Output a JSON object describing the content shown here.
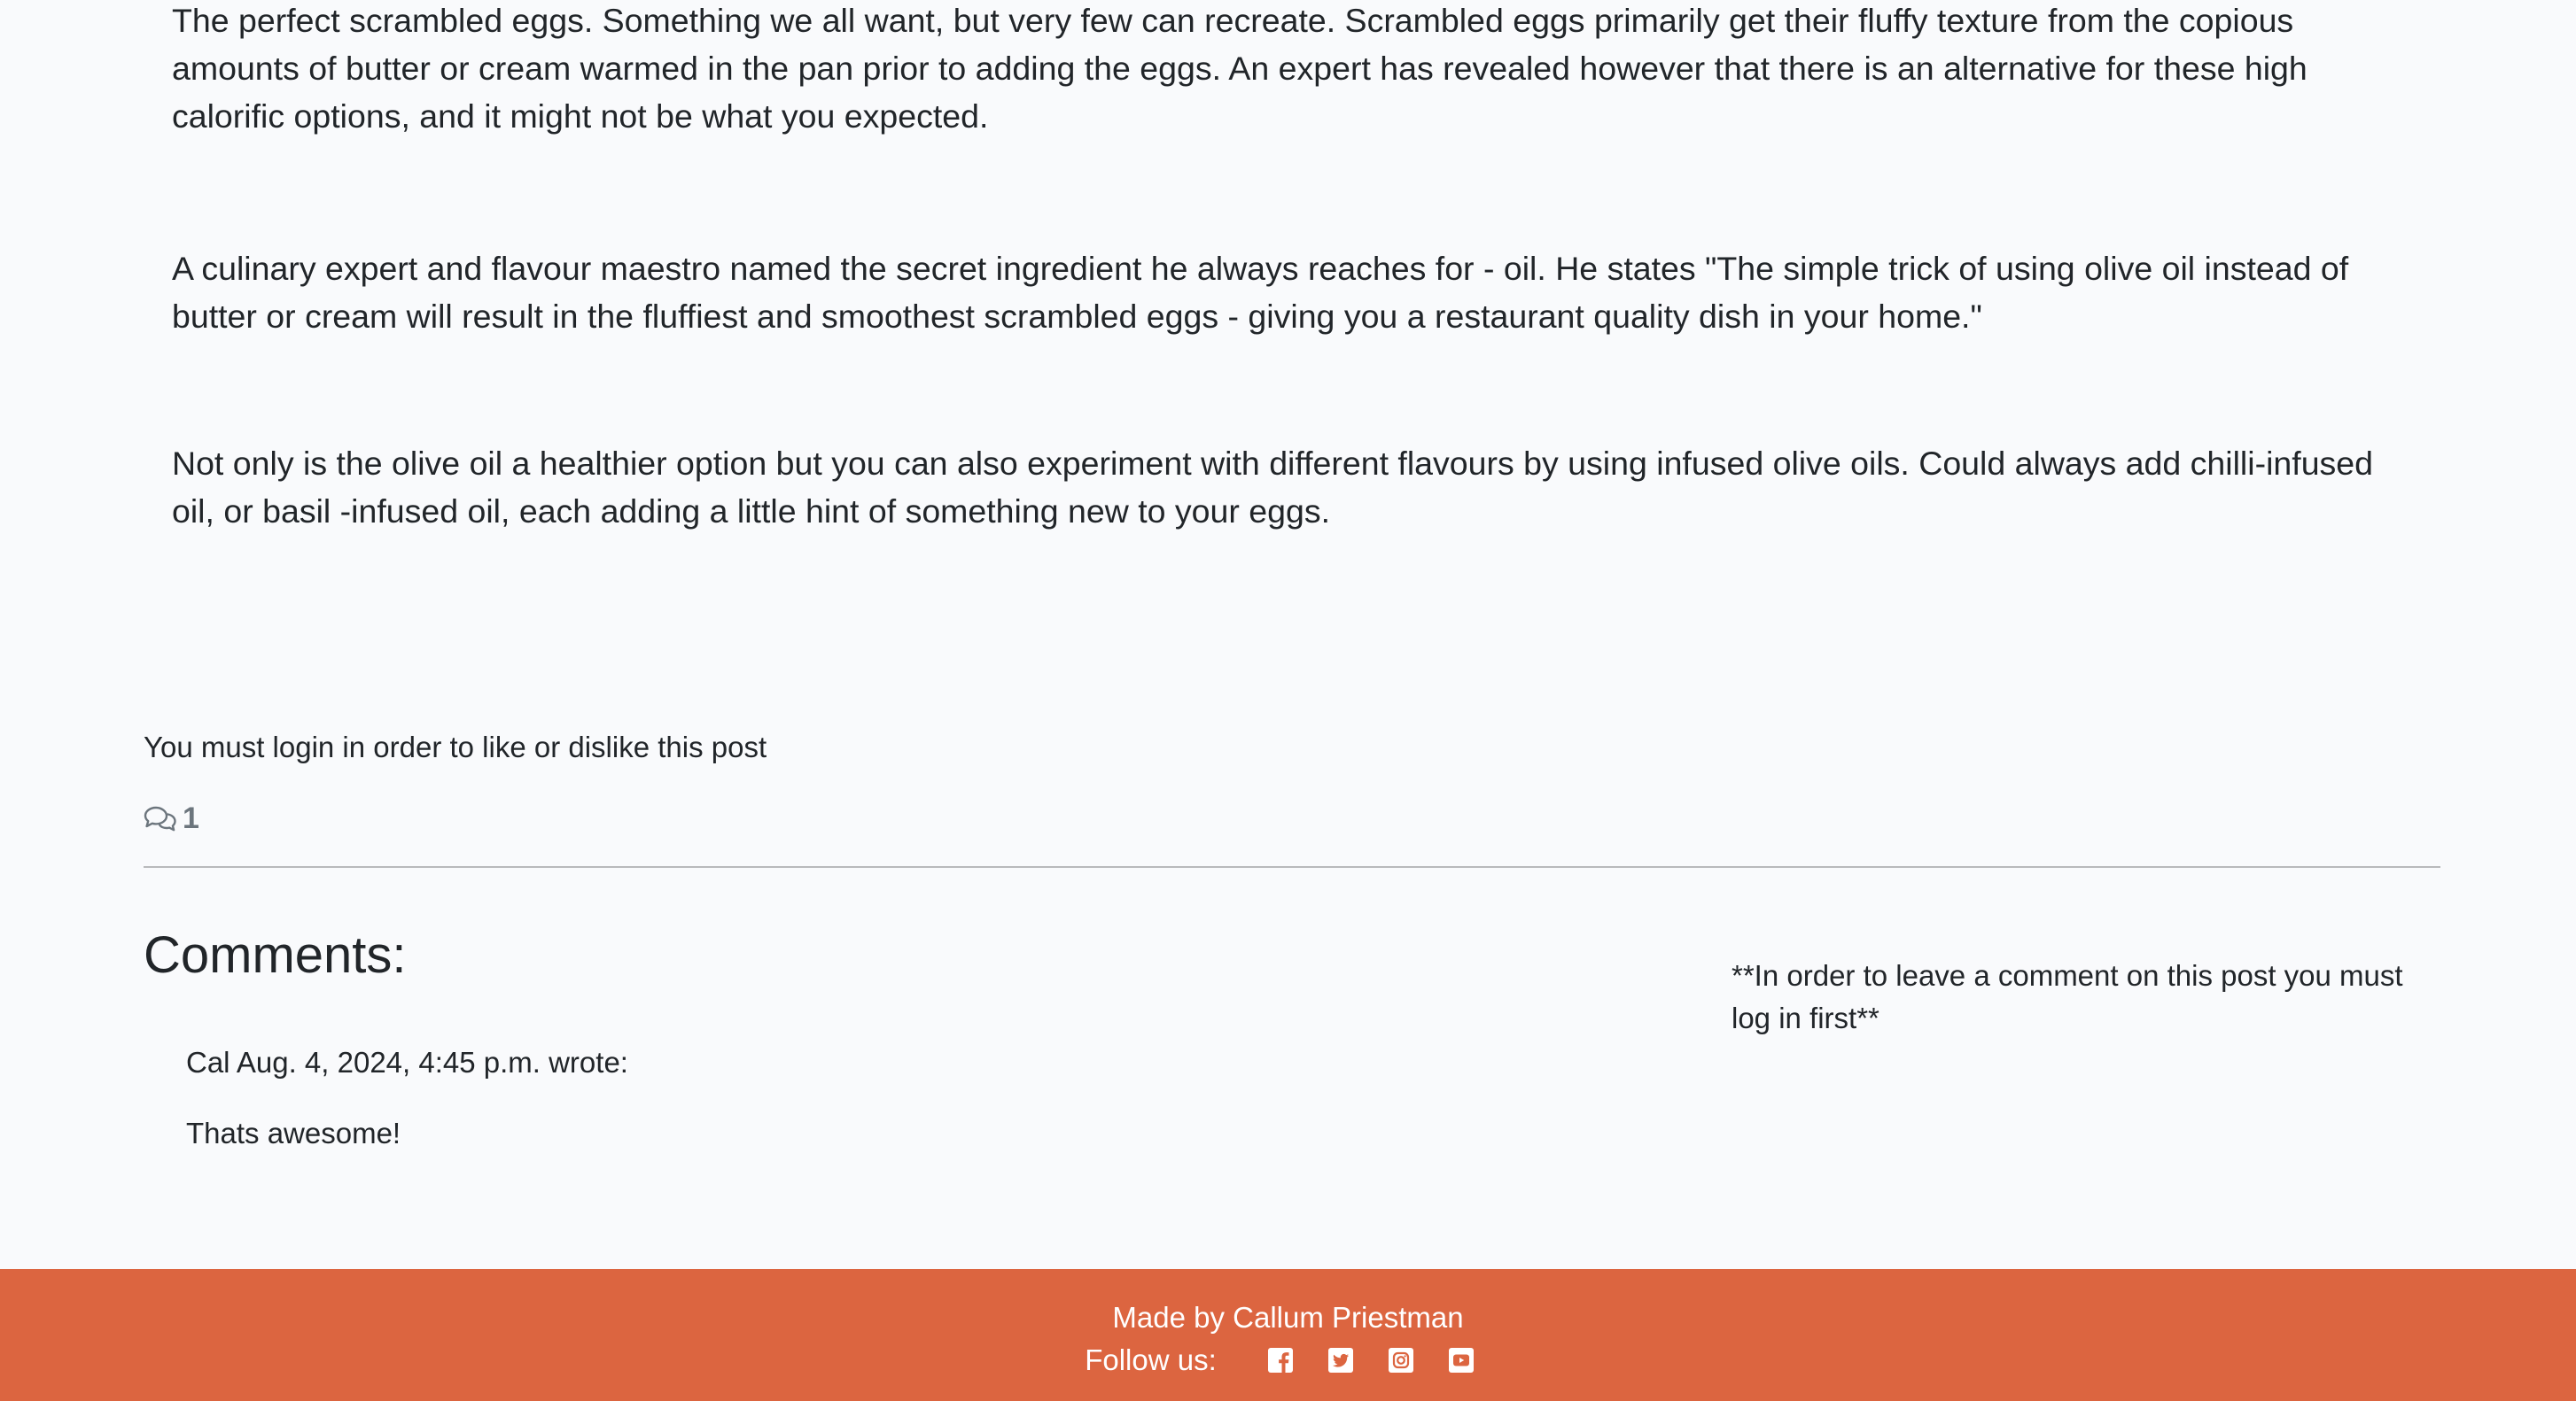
{
  "article": {
    "paragraphs": [
      "The perfect scrambled eggs. Something we all want, but very few can recreate. Scrambled eggs primarily get their fluffy texture from the copious amounts of butter or cream warmed in the pan prior to adding the eggs. An expert has revealed however that there is an alternative for these high calorific options, and it might not be what you expected.",
      "A culinary expert and flavour maestro named the secret ingredient he always reaches for - oil. He states \"The simple trick of using olive oil instead of butter or cream will result in the fluffiest and smoothest scrambled eggs - giving you a restaurant quality dish in your home.\"",
      "Not only is the olive oil a healthier option but you can also experiment with different flavours by using infused olive oils. Could always add chilli-infused oil, or basil -infused oil, each adding a little hint of something new to your eggs."
    ]
  },
  "reactions": {
    "login_note": "You must login in order to like or dislike this post",
    "comment_icon": "comments-icon",
    "comment_count": "1"
  },
  "comments": {
    "heading": "Comments:",
    "items": [
      {
        "meta": "Cal Aug. 4, 2024, 4:45 p.m. wrote:",
        "body": "Thats awesome!"
      }
    ],
    "login_required_note": "**In order to leave a comment on this post you must log in first**"
  },
  "footer": {
    "made_by": "Made by Callum Priestman",
    "follow_label": "Follow us:",
    "social_icons": [
      "facebook-icon",
      "twitter-icon",
      "instagram-icon",
      "youtube-icon"
    ],
    "background_color": "#dc6540",
    "text_color": "#ffffff"
  },
  "colors": {
    "page_background": "#f9fafc",
    "text": "#212529",
    "muted": "#6c757d"
  }
}
